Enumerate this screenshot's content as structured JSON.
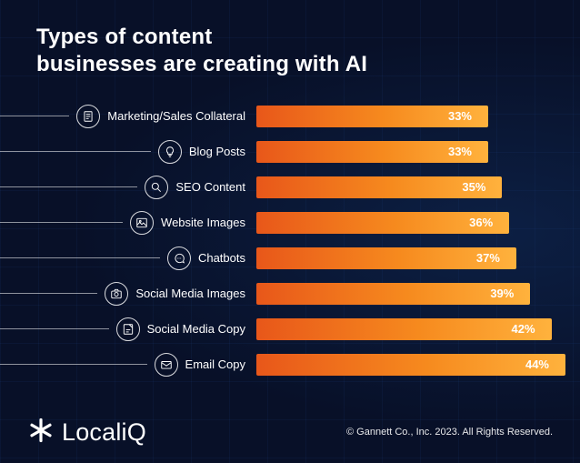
{
  "title_line1": "Types of content",
  "title_line2": "businesses are creating with AI",
  "brand": "LocaliQ",
  "copyright": "© Gannett Co., Inc. 2023. All Rights Reserved.",
  "chart_data": {
    "type": "bar",
    "title": "Types of content businesses are creating with AI",
    "xlabel": "",
    "ylabel": "",
    "ylim": [
      0,
      50
    ],
    "categories": [
      "Marketing/Sales Collateral",
      "Blog Posts",
      "SEO Content",
      "Website Images",
      "Chatbots",
      "Social Media Images",
      "Social Media Copy",
      "Email Copy"
    ],
    "values": [
      33,
      33,
      35,
      36,
      37,
      39,
      42,
      44
    ],
    "icons": [
      "document-icon",
      "lightbulb-icon",
      "search-icon",
      "image-icon",
      "chat-icon",
      "camera-icon",
      "note-icon",
      "mail-icon"
    ]
  }
}
